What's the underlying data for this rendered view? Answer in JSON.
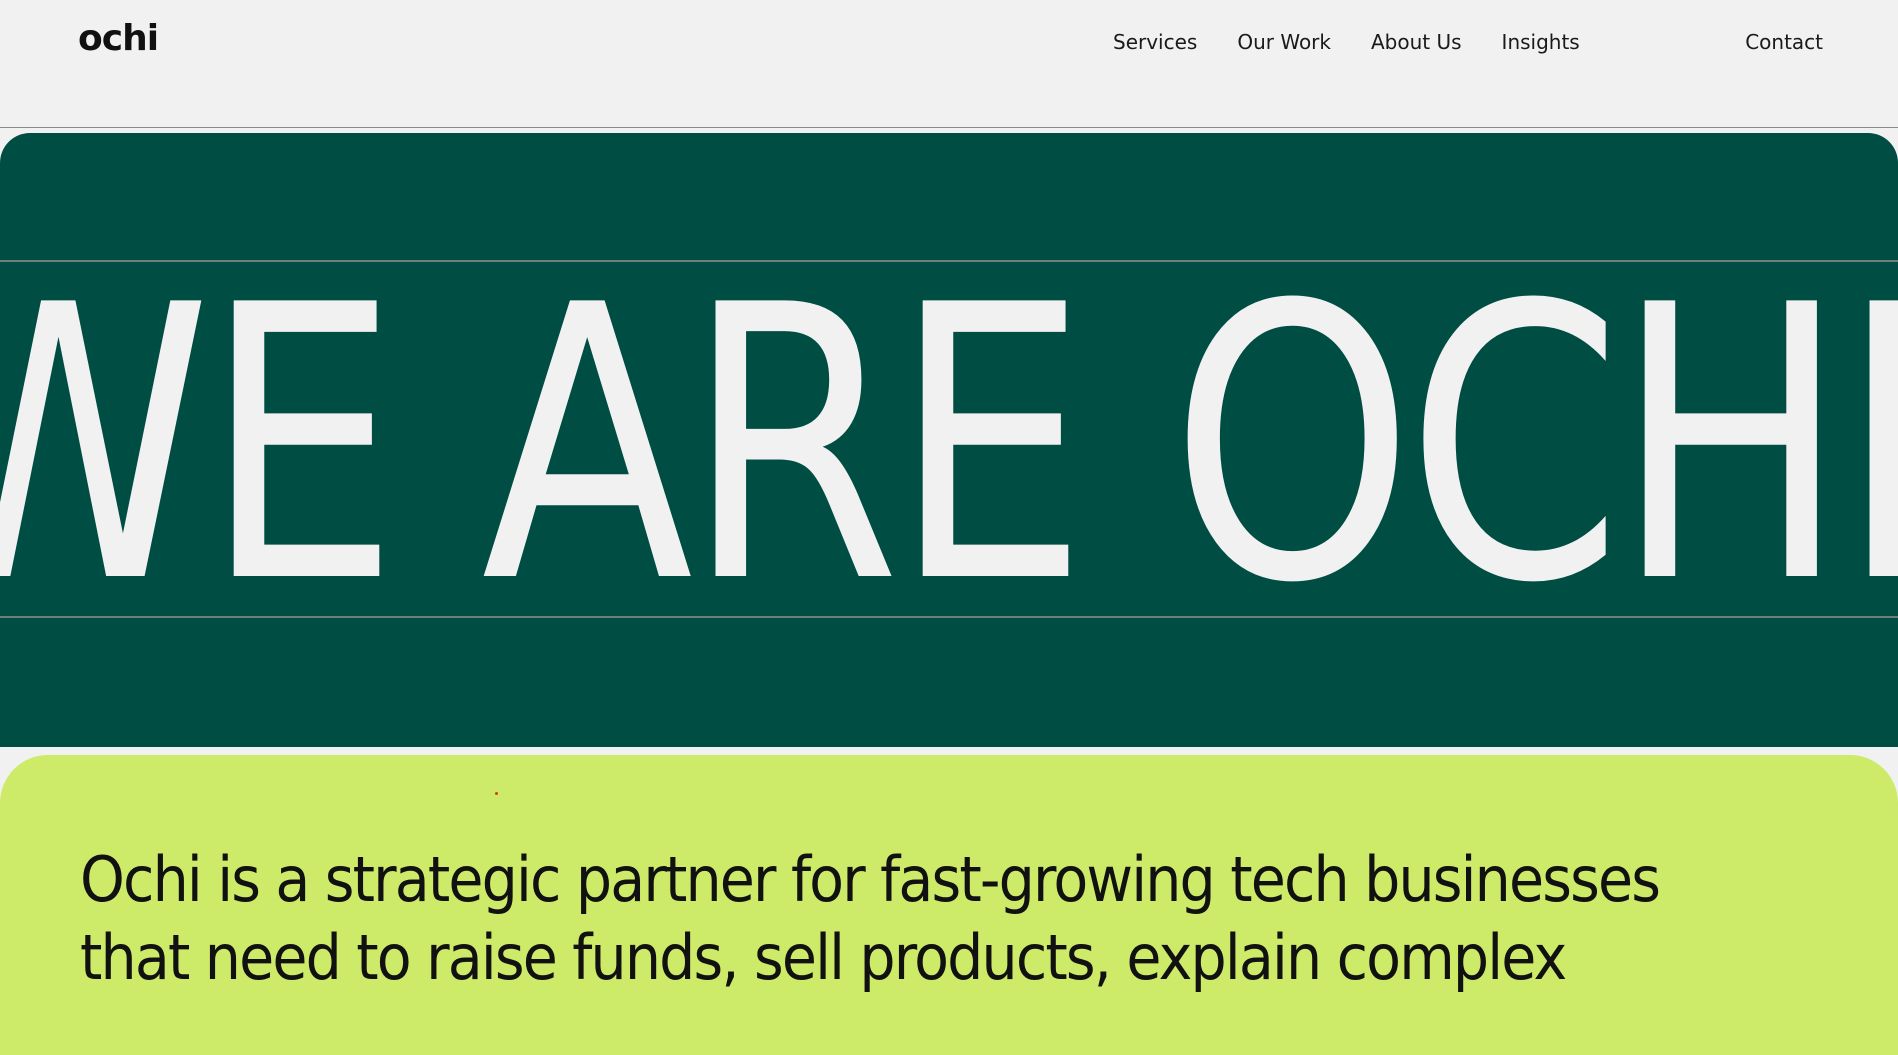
{
  "navbar": {
    "logo": "ochi",
    "links": [
      "Services",
      "Our Work",
      "About Us",
      "Insights"
    ],
    "contact": "Contact"
  },
  "hero": {
    "marquee_text": "WE ARE OCHI"
  },
  "about": {
    "lines": [
      "Ochi is a strategic partner for fast-growing tech businesses",
      "that need to raise funds, sell products, explain complex"
    ]
  },
  "colors": {
    "background": "#f1f1f1",
    "hero_green": "#004d43",
    "lime": "#cdea68",
    "text": "#111111"
  }
}
